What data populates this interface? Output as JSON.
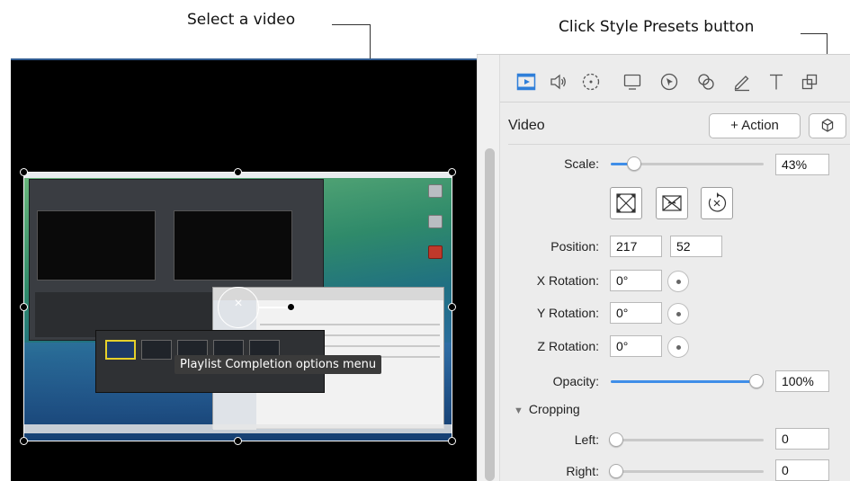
{
  "callouts": {
    "select_video": "Select a video",
    "style_presets": "Click Style Presets button"
  },
  "canvas": {
    "tooltip": "Playlist Completion options menu"
  },
  "tabs": [
    {
      "icon": "video-film-icon"
    },
    {
      "icon": "audio-speaker-icon"
    },
    {
      "icon": "transition-dashed-circle-icon"
    },
    {
      "icon": "screen-monitor-icon"
    },
    {
      "icon": "cursor-icon"
    },
    {
      "icon": "filters-circles-icon"
    },
    {
      "icon": "annotation-pen-icon"
    },
    {
      "icon": "text-t-icon"
    },
    {
      "icon": "layout-icon"
    }
  ],
  "panel": {
    "title": "Video",
    "action_button": "+ Action",
    "scale": {
      "label": "Scale:",
      "value": "43%",
      "level": 0.12
    },
    "position": {
      "label": "Position:",
      "x": "217",
      "y": "52"
    },
    "x_rotation": {
      "label": "X Rotation:",
      "value": "0°"
    },
    "y_rotation": {
      "label": "Y Rotation:",
      "value": "0°"
    },
    "z_rotation": {
      "label": "Z Rotation:",
      "value": "0°"
    },
    "opacity": {
      "label": "Opacity:",
      "value": "100%",
      "level": 1.0
    },
    "cropping": {
      "title": "Cropping",
      "left": {
        "label": "Left:",
        "value": "0"
      },
      "right": {
        "label": "Right:",
        "value": "0"
      }
    }
  },
  "colors": {
    "accent": "#3f8ee8",
    "selected_tab": "#2f7fd9"
  }
}
